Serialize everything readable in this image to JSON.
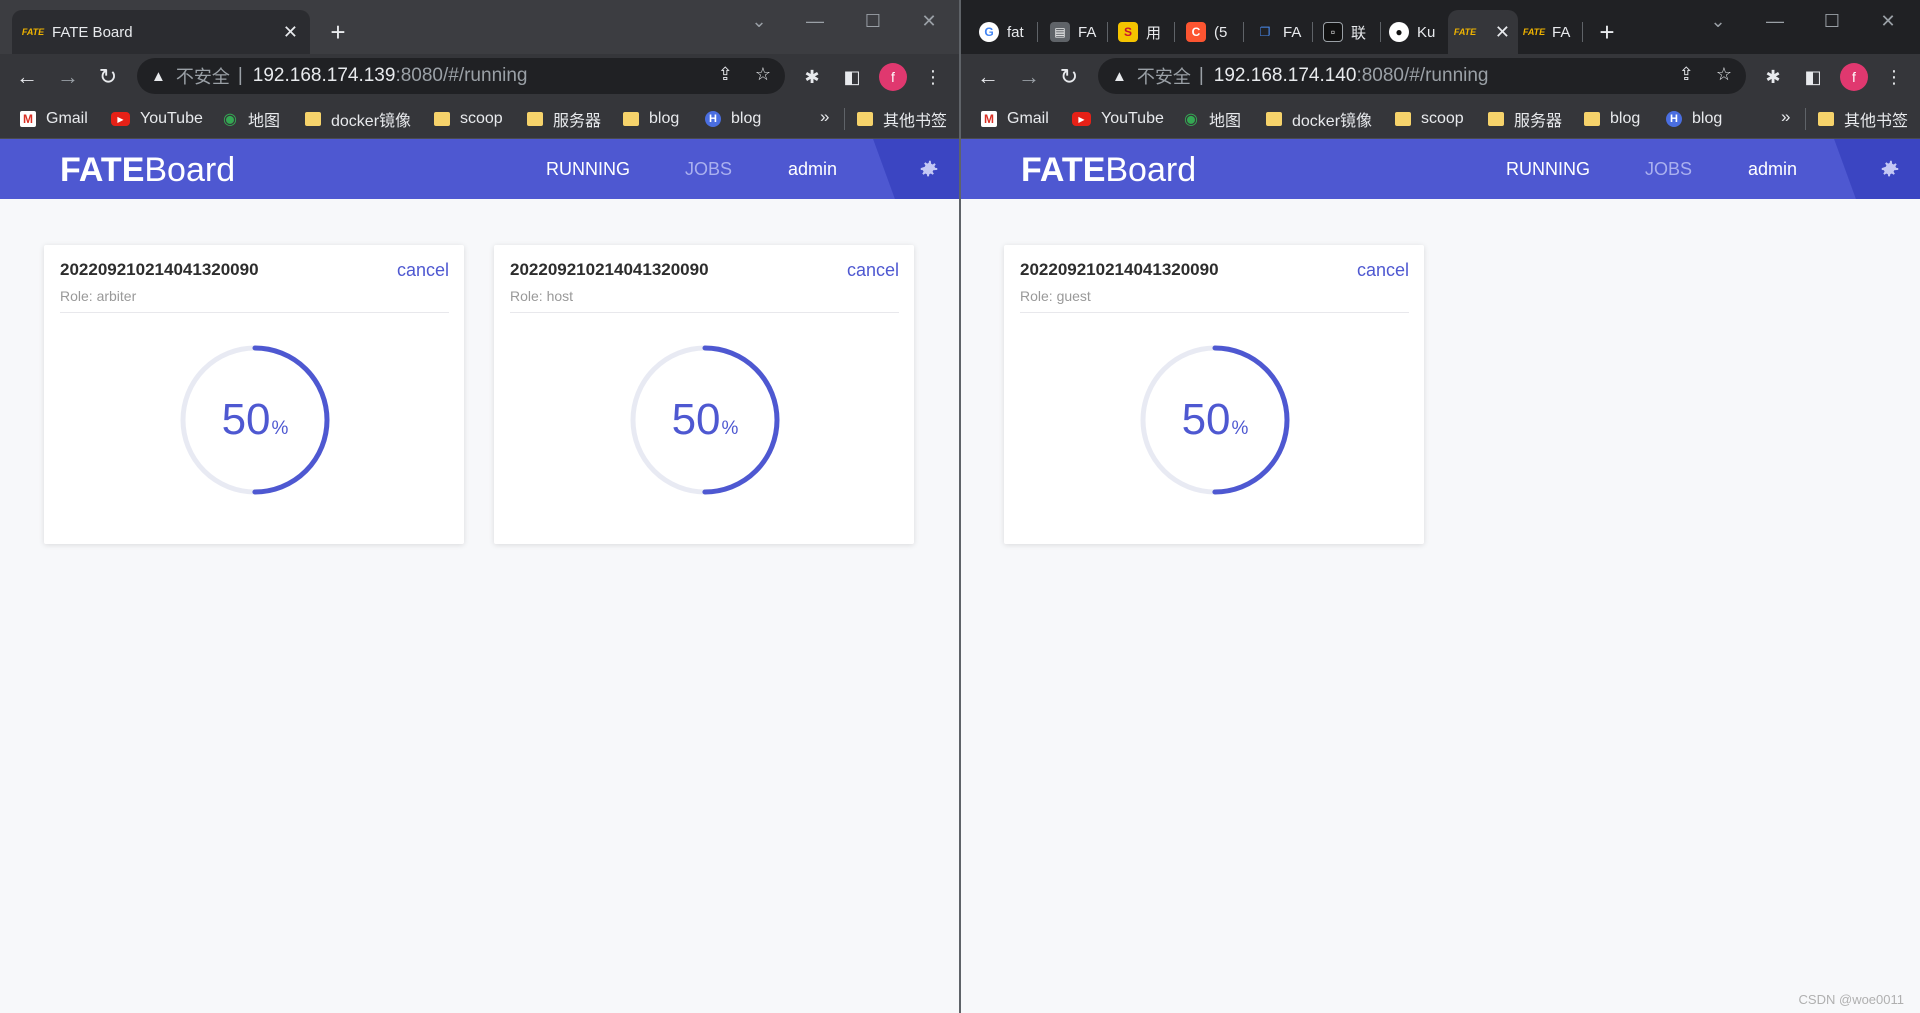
{
  "left_window": {
    "tab": {
      "title": "FATE Board",
      "favicon": "FATE"
    },
    "omnibox": {
      "security": "不安全",
      "host": "192.168.174.139",
      "rest": ":8080/#/running"
    },
    "profile_initial": "f"
  },
  "right_window": {
    "tabs": [
      {
        "label": "fat",
        "icon": "google-icon"
      },
      {
        "label": "FA",
        "icon": "sheet-icon"
      },
      {
        "label": "用",
        "icon": "s-icon"
      },
      {
        "label": "(5",
        "icon": "c-icon"
      },
      {
        "label": "FA",
        "icon": "chat-icon"
      },
      {
        "label": "联",
        "icon": "chat-bubble-icon"
      },
      {
        "label": "Ku",
        "icon": "github-icon"
      },
      {
        "label": "",
        "icon": "fate-icon"
      },
      {
        "label": "FA",
        "icon": "fate-icon"
      }
    ],
    "omnibox": {
      "security": "不安全",
      "host": "192.168.174.140",
      "rest": ":8080/#/running"
    },
    "profile_initial": "f"
  },
  "bookmarks": {
    "items": [
      "Gmail",
      "YouTube",
      "地图",
      "docker镜像",
      "scoop",
      "服务器",
      "blog",
      "blog"
    ],
    "more": "»",
    "other": "其他书签"
  },
  "app": {
    "brand_bold": "FATE",
    "brand_light": "Board",
    "nav": {
      "running": "RUNNING",
      "jobs": "JOBS",
      "user": "admin"
    },
    "accent": "#4e58d1"
  },
  "cards_left": [
    {
      "job_id": "202209210214041320090",
      "role": "Role: arbiter",
      "action": "cancel",
      "progress": 50,
      "unit": "%"
    },
    {
      "job_id": "202209210214041320090",
      "role": "Role: host",
      "action": "cancel",
      "progress": 50,
      "unit": "%"
    }
  ],
  "cards_right": [
    {
      "job_id": "202209210214041320090",
      "role": "Role: guest",
      "action": "cancel",
      "progress": 50,
      "unit": "%"
    }
  ],
  "watermark": "CSDN @woe0011"
}
